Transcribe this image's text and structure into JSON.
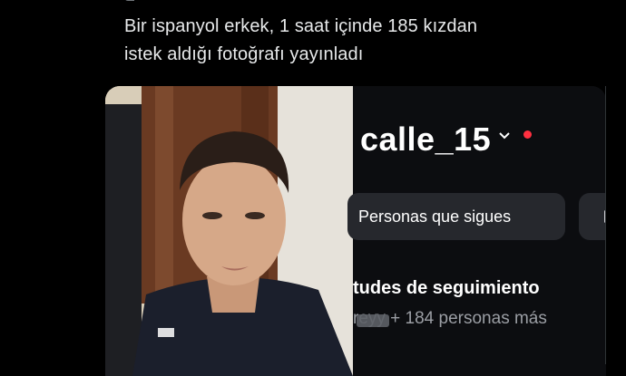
{
  "tweet": {
    "text_line1": "Bir ispanyol erkek, 1 saat içinde 185 kızdan",
    "text_line2": "istek aldığı fotoğrafı yayınladı"
  },
  "instagram": {
    "username": "calle_15",
    "following_label": "Personas que sigues",
    "requests_title": "tudes de seguimiento",
    "requests_subtitle": "reyy + 184 personas más"
  },
  "colors": {
    "background": "#000000",
    "text": "#e7e9ea",
    "notification_dot": "#ff3040"
  }
}
